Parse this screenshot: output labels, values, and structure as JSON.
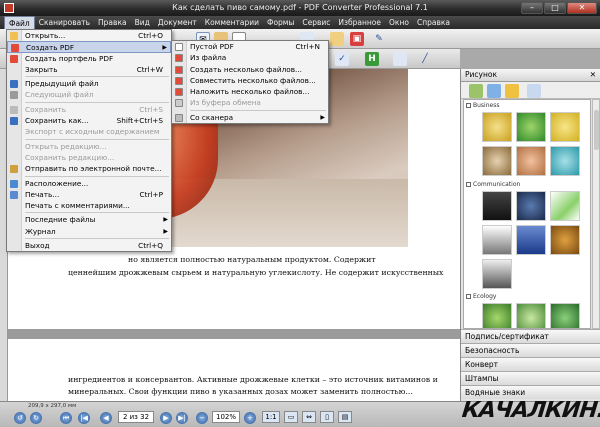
{
  "window": {
    "title": "Как сделать пиво самому.pdf - PDF Converter Professional 7.1"
  },
  "menubar": [
    "Файл",
    "Сканировать",
    "Правка",
    "Вид",
    "Документ",
    "Комментарии",
    "Формы",
    "Сервис",
    "Избранное",
    "Окно",
    "Справка"
  ],
  "file_menu": [
    {
      "label": "Открыть...",
      "shortcut": "Ctrl+O",
      "disabled": false
    },
    {
      "label": "Создать PDF",
      "shortcut": "",
      "submenu": true,
      "highlighted": true
    },
    {
      "label": "Создать портфель PDF",
      "shortcut": ""
    },
    {
      "label": "Закрыть",
      "shortcut": "Ctrl+W"
    },
    {
      "sep": true
    },
    {
      "label": "Предыдущий файл",
      "shortcut": ""
    },
    {
      "label": "Следующий файл",
      "shortcut": "",
      "disabled": true
    },
    {
      "sep": true
    },
    {
      "label": "Сохранить",
      "shortcut": "Ctrl+S",
      "disabled": true
    },
    {
      "label": "Сохранить как...",
      "shortcut": "Shift+Ctrl+S"
    },
    {
      "label": "Экспорт с исходным содержанием",
      "disabled": true
    },
    {
      "sep": true
    },
    {
      "label": "Открыть редакцию...",
      "disabled": true
    },
    {
      "label": "Сохранить редакцию...",
      "disabled": true
    },
    {
      "label": "Отправить по электронной почте..."
    },
    {
      "sep": true
    },
    {
      "label": "Расположение..."
    },
    {
      "label": "Печать...",
      "shortcut": "Ctrl+P"
    },
    {
      "label": "Печать с комментариями..."
    },
    {
      "sep": true
    },
    {
      "label": "Последние файлы",
      "submenu": true
    },
    {
      "label": "Журнал",
      "submenu": true
    },
    {
      "sep": true
    },
    {
      "label": "Выход",
      "shortcut": "Ctrl+Q"
    }
  ],
  "create_submenu": [
    {
      "label": "Пустой PDF",
      "shortcut": "Ctrl+N"
    },
    {
      "label": "Из файла"
    },
    {
      "label": "Создать несколько файлов..."
    },
    {
      "label": "Совместить несколько файлов..."
    },
    {
      "label": "Наложить несколько файлов..."
    },
    {
      "label": "Из буфера обмена",
      "disabled": true
    },
    {
      "sep": true
    },
    {
      "label": "Со сканера",
      "submenu": true
    }
  ],
  "document": {
    "line1": "но является полностью натуральным продуктом. Содержит",
    "line2": "ценнейшим дрожжевым сырьем и натуральную углекислоту. Не содержит искусственных",
    "line3": "ингредиентов и консервантов. Активные дрожжевые клетки – это источник витаминов и",
    "line4": "минеральных. Свои функции пиво в указанных дозах может заменить полностью..."
  },
  "right_panel": {
    "title": "Рисунок",
    "categories": [
      "Business",
      "Communication",
      "Ecology"
    ],
    "accordion": [
      "Подпись/сертификат",
      "Безопасность",
      "Конверт",
      "Штампы",
      "Водяные знаки"
    ]
  },
  "statusbar": {
    "dimensions": "209,9 x 297,0 мм",
    "page_field": "2 из 32",
    "zoom": "102%"
  },
  "watermark": "КАЧАЛКИН.РУ"
}
